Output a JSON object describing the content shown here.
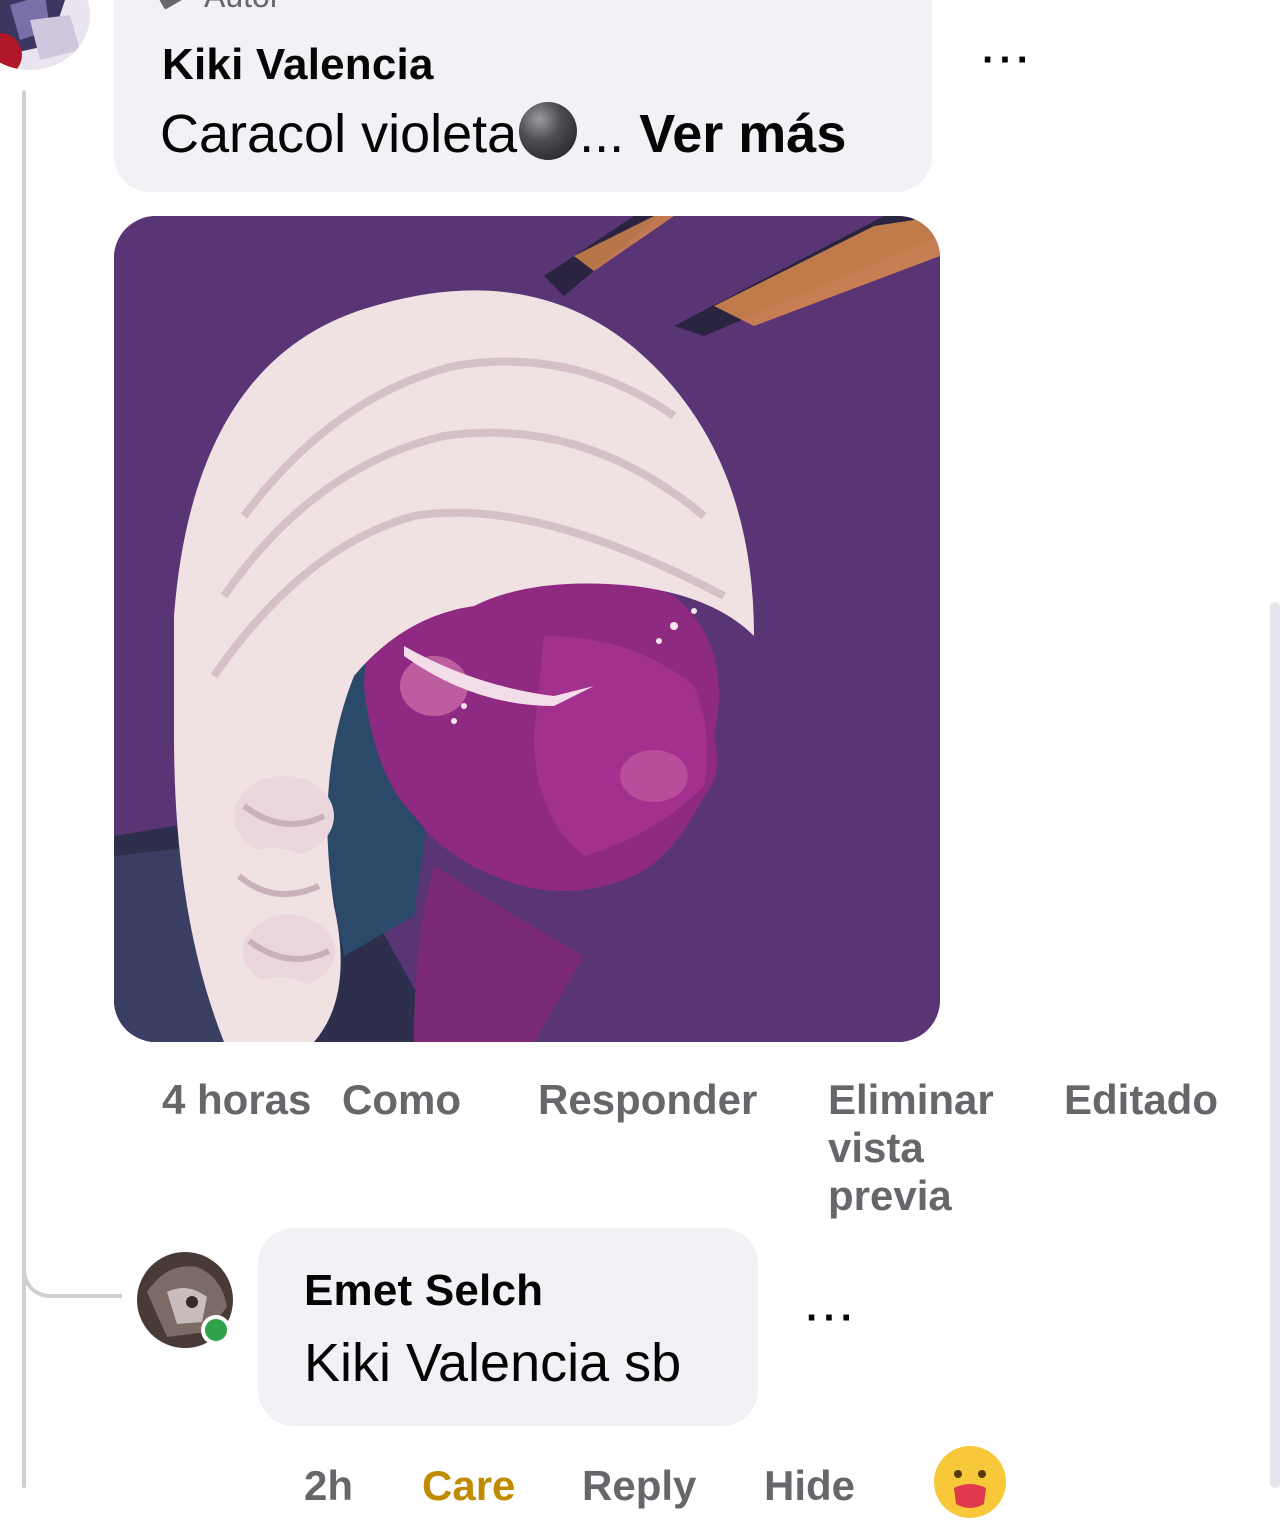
{
  "comment": {
    "badge": "Autor",
    "author": "Kiki Valencia",
    "text_before": "Caracol violeta",
    "emoji": "black-circle",
    "ellipsis": "...",
    "see_more": "Ver más",
    "more_options": "···"
  },
  "comment_actions": {
    "time": "4 horas",
    "like": "Como",
    "reply": "Responder",
    "remove_preview": "Eliminar vista previa",
    "edited": "Editado"
  },
  "reply": {
    "author": "Emet Selch",
    "text": "Kiki Valencia sb",
    "more_options": "···",
    "online": true
  },
  "reply_actions": {
    "time": "2h",
    "care": "Care",
    "reply": "Reply",
    "hide": "Hide",
    "reaction_icon": "care-reaction-icon"
  },
  "colors": {
    "bubble": "#f0f2f5",
    "secondary_text": "#65676b",
    "online": "#31a24c",
    "care_label": "#c08b00",
    "image_background": "#5a3576"
  }
}
